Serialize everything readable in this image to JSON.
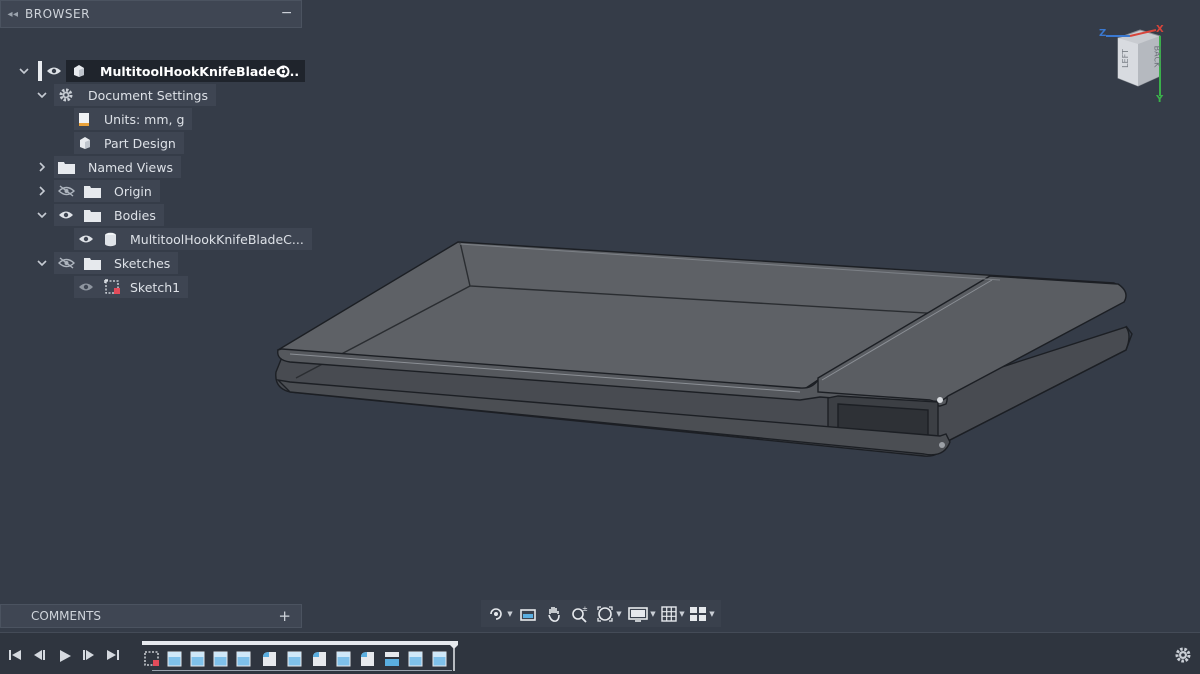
{
  "browser": {
    "title": "BROWSER",
    "root": {
      "label": "MultitoolHookKnifeBladeC..."
    },
    "items": [
      {
        "label": "Document Settings",
        "icon": "gear-icon"
      },
      {
        "label": "Units: mm, g",
        "icon": "document-icon"
      },
      {
        "label": "Part Design",
        "icon": "component-icon"
      },
      {
        "label": "Named Views",
        "icon": "folder-icon"
      },
      {
        "label": "Origin",
        "icon": "folder-icon"
      },
      {
        "label": "Bodies",
        "icon": "folder-icon"
      },
      {
        "label": "MultitoolHookKnifeBladeC...",
        "icon": "body-icon"
      },
      {
        "label": "Sketches",
        "icon": "folder-icon"
      },
      {
        "label": "Sketch1",
        "icon": "sketch-icon"
      }
    ]
  },
  "comments": {
    "title": "COMMENTS"
  },
  "viewcube": {
    "face": "LEFT",
    "side": "BACK",
    "axis_z": "Z",
    "axis_x": "X",
    "axis_y": "Y"
  },
  "colors": {
    "background": "#353c48",
    "panel": "#3f4653",
    "selected": "#1f242c",
    "timeline_feature": "#5aaee0"
  }
}
